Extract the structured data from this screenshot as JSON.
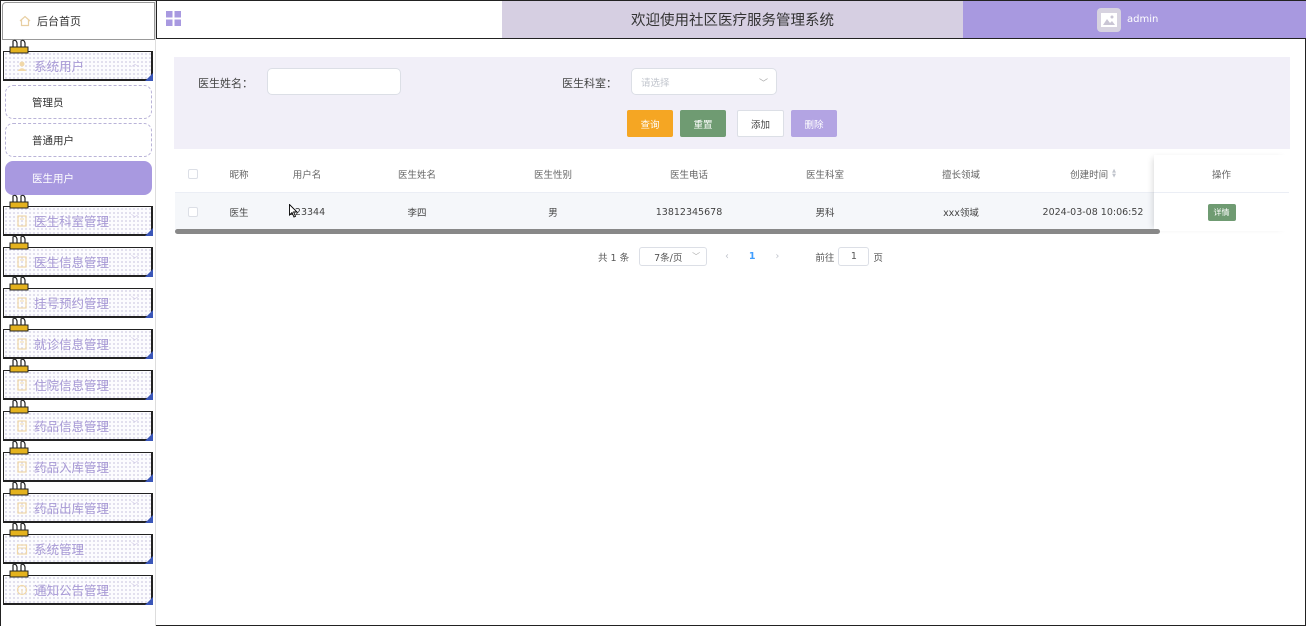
{
  "header": {
    "title": "欢迎使用社区医疗服务管理系统",
    "username": "admin"
  },
  "sidebar": {
    "home_label": "后台首页",
    "menus": [
      {
        "label": "系统用户",
        "icon": "user-icon",
        "expanded": true,
        "children": [
          {
            "label": "管理员",
            "active": false
          },
          {
            "label": "普通用户",
            "active": false
          },
          {
            "label": "医生用户",
            "active": true
          }
        ]
      },
      {
        "label": "医生科室管理",
        "icon": "document-icon"
      },
      {
        "label": "医生信息管理",
        "icon": "document-icon"
      },
      {
        "label": "挂号预约管理",
        "icon": "document-icon"
      },
      {
        "label": "就诊信息管理",
        "icon": "document-icon"
      },
      {
        "label": "住院信息管理",
        "icon": "document-icon"
      },
      {
        "label": "药品信息管理",
        "icon": "document-icon"
      },
      {
        "label": "药品入库管理",
        "icon": "document-icon"
      },
      {
        "label": "药品出库管理",
        "icon": "document-icon"
      },
      {
        "label": "系统管理",
        "icon": "calendar-icon"
      },
      {
        "label": "通知公告管理",
        "icon": "info-icon"
      }
    ]
  },
  "filter": {
    "doctor_name_label": "医生姓名：",
    "doctor_name_value": "",
    "department_label": "医生科室：",
    "department_placeholder": "请选择",
    "buttons": {
      "query": "查询",
      "reset": "重置",
      "add": "添加",
      "delete": "删除"
    }
  },
  "table": {
    "columns": [
      "昵称",
      "用户名",
      "医生姓名",
      "医生性别",
      "医生电话",
      "医生科室",
      "擅长领域",
      "创建时间",
      "操作"
    ],
    "rows": [
      {
        "nickname": "医生",
        "username": "123344",
        "doctor_name": "李四",
        "gender": "男",
        "phone": "13812345678",
        "department": "男科",
        "specialty": "xxx领域",
        "created_at": "2024-03-08 10:06:52",
        "action": "详情"
      }
    ]
  },
  "pagination": {
    "total_text": "共 1 条",
    "page_size": "7条/页",
    "current_page": "1",
    "goto_prefix": "前往",
    "goto_value": "1",
    "goto_suffix": "页"
  },
  "colors": {
    "accent": "#a899e0",
    "title_bar": "#d6cfe2",
    "query_btn": "#f5a623",
    "reset_btn": "#6f9b72",
    "delete_btn": "#b3a4e3"
  }
}
